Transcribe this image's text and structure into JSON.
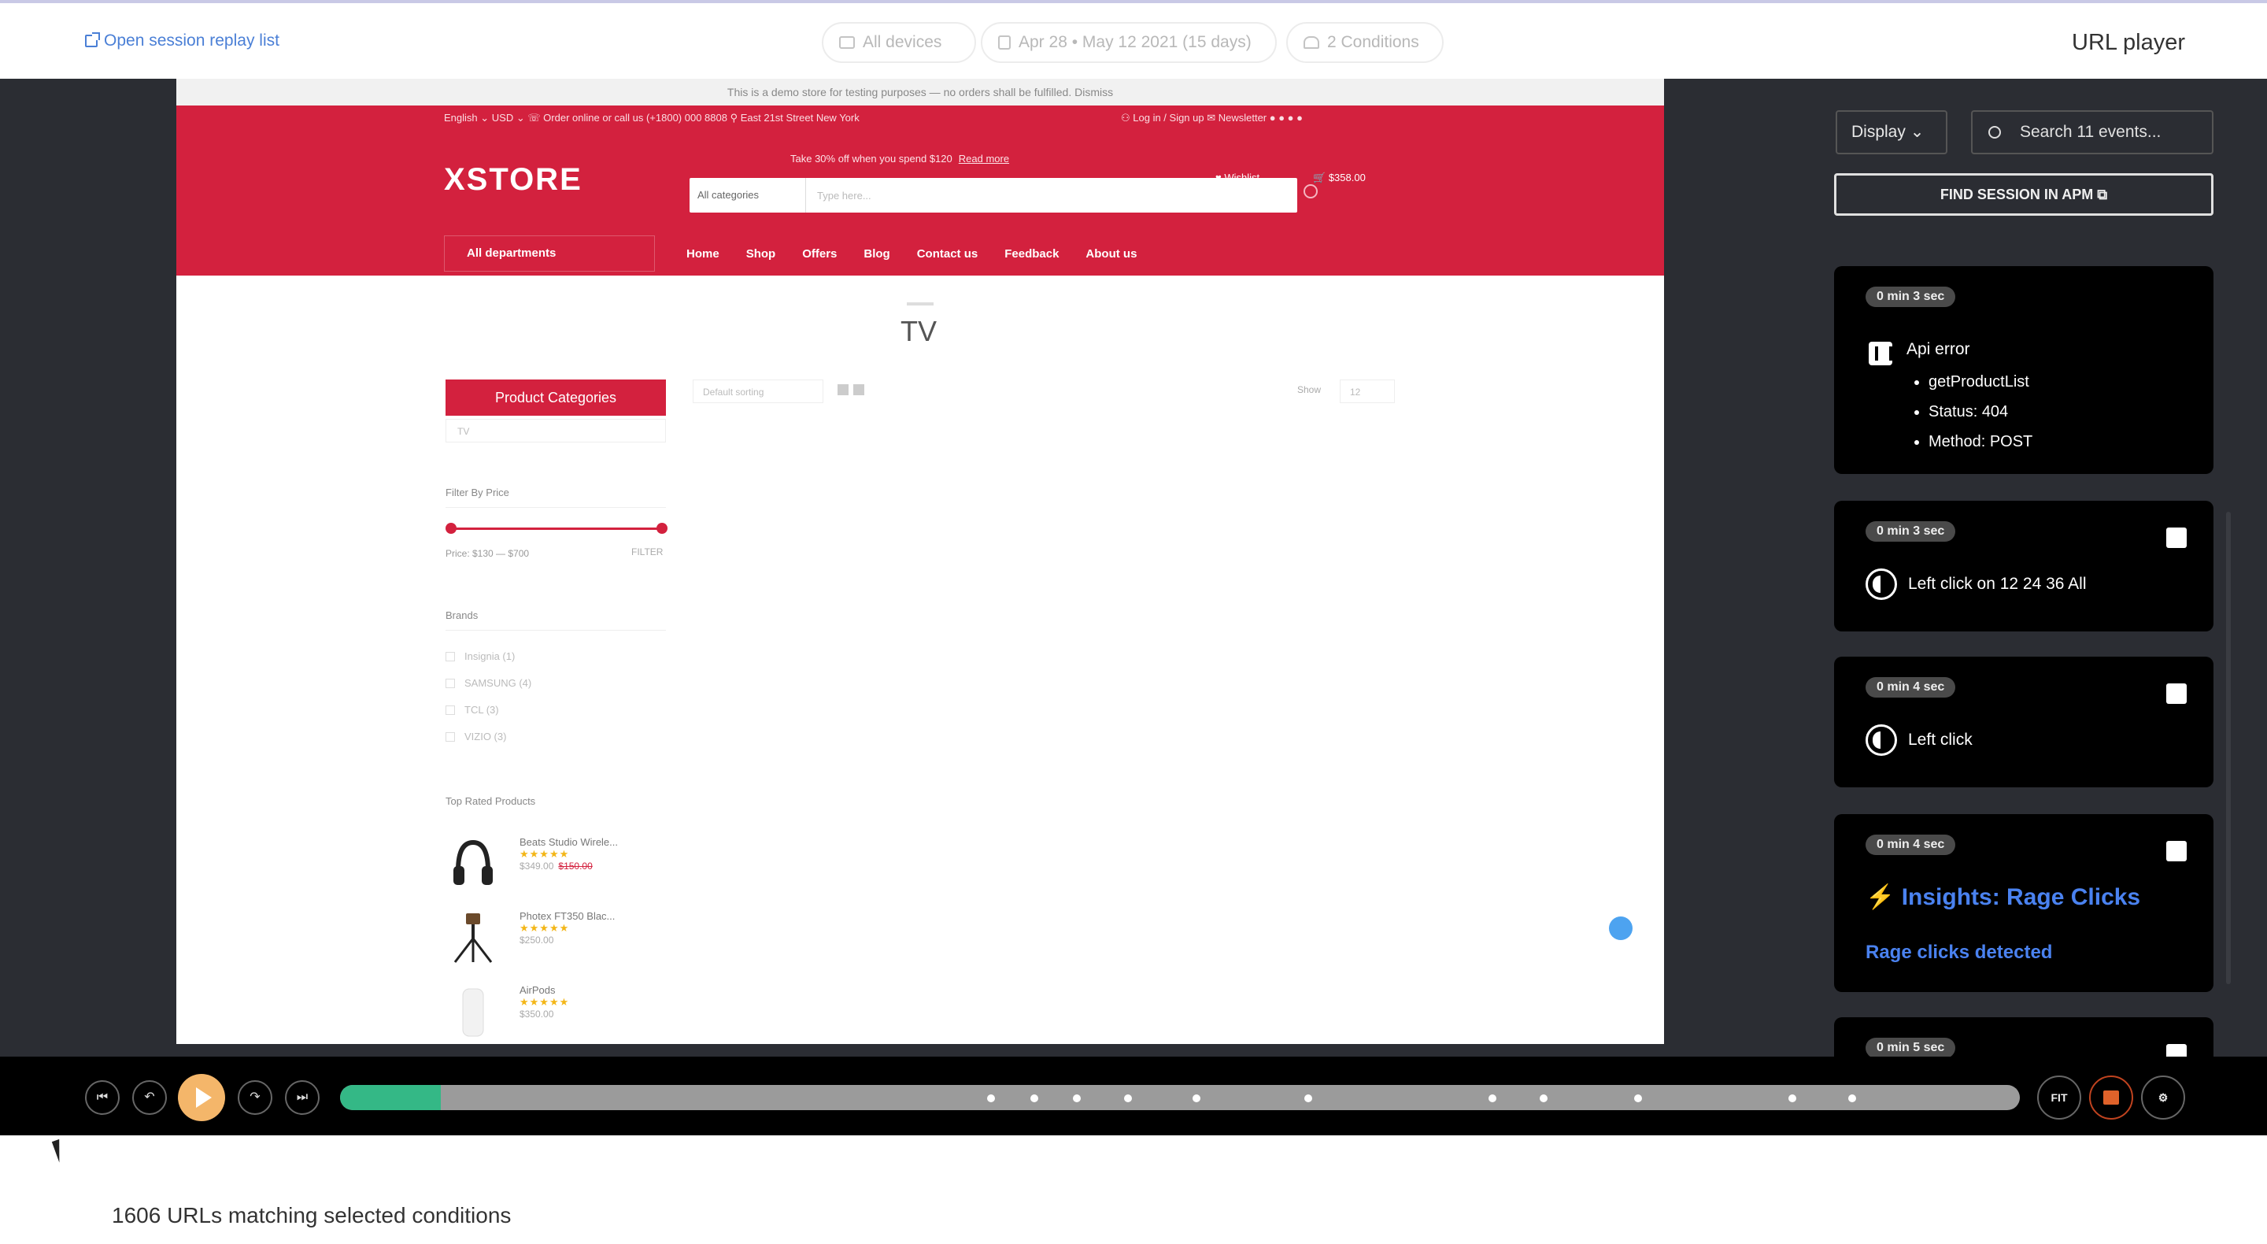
{
  "topbar": {
    "open_link": "Open session replay list",
    "devices": "All devices",
    "date_range": "Apr 28 • May 12 2021 (15 days)",
    "conditions": "2 Conditions",
    "title": "URL player"
  },
  "site": {
    "demo_notice": "This is a demo store for testing purposes — no orders shall be fulfilled. Dismiss",
    "top_left": "English ⌄   USD ⌄   ☏ Order online or call us (+1800) 000 8808   ⚲ East 21st Street New York",
    "top_right": "⚇ Log in / Sign up   ✉ Newsletter   ● ● ● ●",
    "promo": "Take 30% off when you spend $120",
    "promo_link": "Read more",
    "logo": "XSTORE",
    "search_category": "All categories",
    "search_placeholder": "Type here...",
    "wishlist": "Wishlist",
    "cart": "$358.00",
    "departments": "All departments",
    "nav": [
      "Home",
      "Shop",
      "Offers",
      "Blog",
      "Contact us",
      "Feedback",
      "About us"
    ],
    "page_title": "TV",
    "product_categories": "Product Categories",
    "category_select": "TV",
    "sort_select": "Default sorting",
    "show_label": "Show",
    "show_value": "12",
    "filter_by_price": "Filter By Price",
    "price_text": "Price: $130 — $700",
    "filter_button": "FILTER",
    "brands_heading": "Brands",
    "brands": [
      "Insignia (1)",
      "SAMSUNG (4)",
      "TCL (3)",
      "VIZIO (3)"
    ],
    "top_rated_heading": "Top Rated Products",
    "products": [
      {
        "name": "Beats Studio Wirele...",
        "stars": "★★★★★",
        "old_price": "$349.00",
        "price": "$150.00"
      },
      {
        "name": "Photex FT350 Blac...",
        "stars": "★★★★★",
        "old_price": "",
        "price": "$250.00"
      },
      {
        "name": "AirPods",
        "stars": "★★★★★",
        "old_price": "",
        "price": "$350.00"
      }
    ]
  },
  "panel": {
    "display": "Display ⌄",
    "search_placeholder": "Search 11 events...",
    "find_apm": "FIND SESSION IN APM ⧉",
    "events": [
      {
        "time": "0 min 3 sec",
        "label": "Api error",
        "details": [
          "getProductList",
          "Status: 404",
          "Method: POST"
        ]
      },
      {
        "time": "0 min 3 sec",
        "label": "Left click on 12 24 36 All"
      },
      {
        "time": "0 min 4 sec",
        "label": "Left click"
      },
      {
        "time": "0 min 4 sec",
        "label": "Insights: Rage Clicks",
        "sub": "Rage clicks detected"
      },
      {
        "time": "0 min 5 sec"
      }
    ]
  },
  "player": {
    "progress": 0.06,
    "ticks": [
      0.152,
      0.162,
      0.172,
      0.184,
      0.2,
      0.226,
      0.269,
      0.281,
      0.303,
      0.339,
      0.353
    ],
    "fit_label": "FIT"
  },
  "footer": {
    "count_text": "1606 URLs matching selected conditions"
  },
  "colors": {
    "brand_red": "#d3213e",
    "timeline_green": "#34b886",
    "play_orange": "#f4b66a",
    "link_blue": "#4a7fd6"
  }
}
